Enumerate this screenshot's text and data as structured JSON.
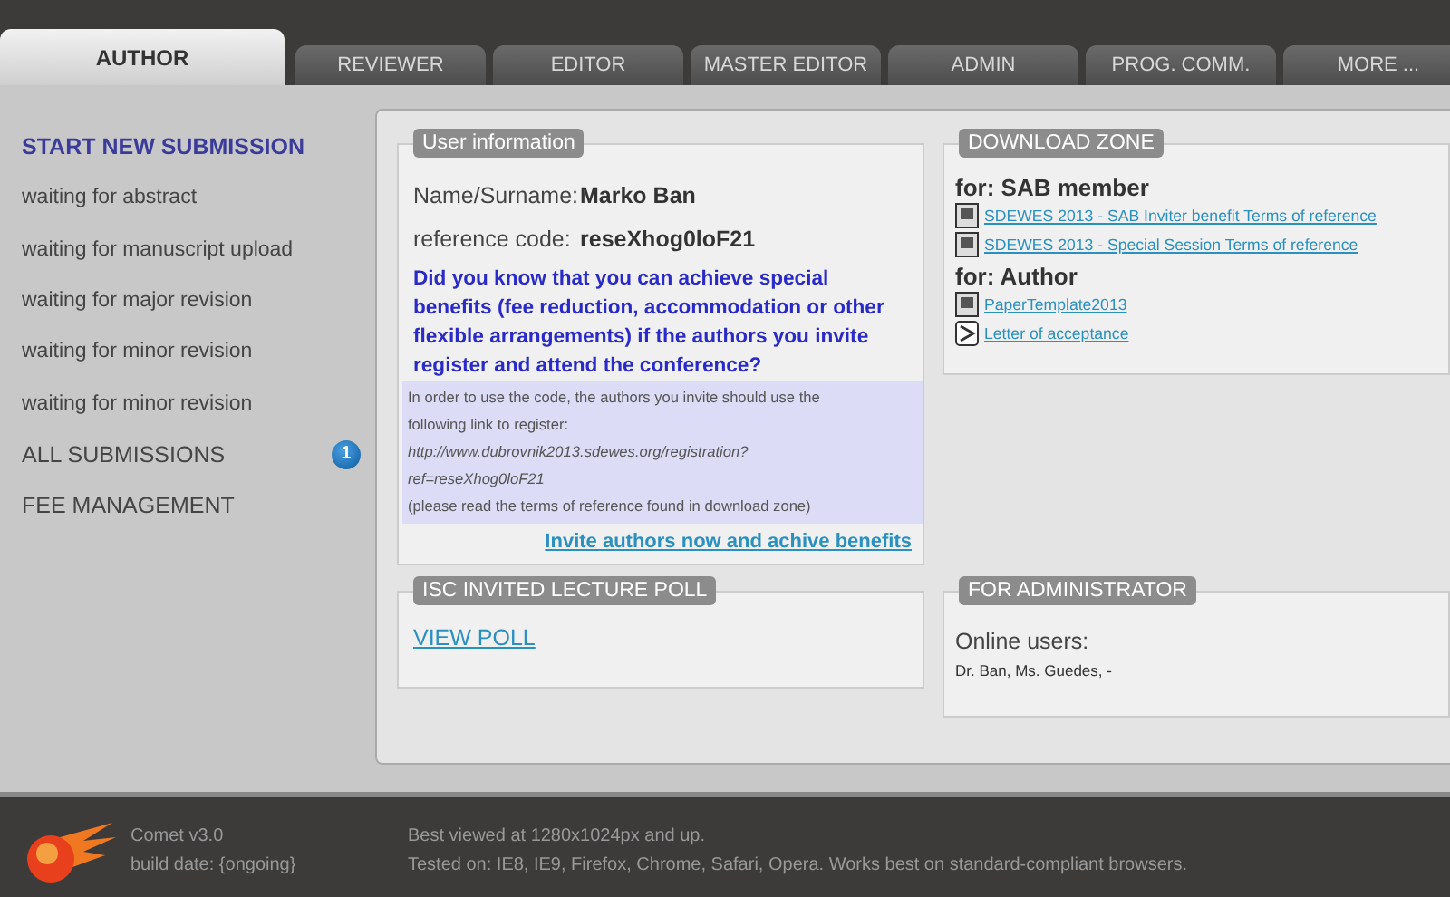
{
  "tabs": [
    {
      "label": "AUTHOR",
      "selected": true
    },
    {
      "label": "REVIEWER",
      "selected": false
    },
    {
      "label": "EDITOR",
      "selected": false
    },
    {
      "label": "MASTER EDITOR",
      "selected": false
    },
    {
      "label": "ADMIN",
      "selected": false
    },
    {
      "label": "PROG. COMM.",
      "selected": false
    },
    {
      "label": "MORE ...",
      "selected": false
    }
  ],
  "sidebar": {
    "items": [
      {
        "label": "START NEW SUBMISSION",
        "kind": "action"
      },
      {
        "label": "waiting for abstract",
        "kind": "filter"
      },
      {
        "label": "waiting for manuscript upload",
        "kind": "filter"
      },
      {
        "label": "waiting for major revision",
        "kind": "filter"
      },
      {
        "label": "waiting for minor revision",
        "kind": "filter"
      },
      {
        "label": "waiting for minor revision",
        "kind": "filter"
      },
      {
        "label": "ALL SUBMISSIONS",
        "kind": "section",
        "badge": "1"
      },
      {
        "label": "FEE MANAGEMENT",
        "kind": "section"
      }
    ]
  },
  "user_information": {
    "title": "User information",
    "fields": [
      {
        "label": "Name/Surname:",
        "value": "Marko Ban"
      },
      {
        "label": "reference code:",
        "value": "reseXhog0loF21"
      }
    ],
    "notice": "Did you know that you can achieve special benefits (fee reduction, accommodation or other flexible arrangements) if the authors you invite register and attend the conference?",
    "instructions": [
      {
        "text": "In order to use the code, the authors you invite should use the",
        "kind": "plain"
      },
      {
        "text": "following link to register:",
        "kind": "plain"
      },
      {
        "text": "http://www.dubrovnik2013.sdewes.org/registration?",
        "kind": "url"
      },
      {
        "text": "ref=reseXhog0loF21",
        "kind": "url"
      },
      {
        "text": "(please read the terms of reference found in download zone)",
        "kind": "plain"
      }
    ],
    "link": "Invite authors now and achive benefits"
  },
  "download_zone": {
    "title": "DOWNLOAD ZONE",
    "groups": [
      {
        "heading": "for: SAB member",
        "files": [
          {
            "label": "SDEWES 2013 - SAB Inviter benefit Terms of reference",
            "kind": "doc"
          },
          {
            "label": "SDEWES 2013 - Special Session Terms of reference",
            "kind": "doc"
          }
        ]
      },
      {
        "heading": "for: Author",
        "files": [
          {
            "label": "PaperTemplate2013",
            "kind": "doc"
          },
          {
            "label": "Letter of acceptance",
            "kind": "pdf"
          }
        ]
      }
    ]
  },
  "poll": {
    "title": "ISC INVITED LECTURE POLL",
    "link": "VIEW POLL"
  },
  "administrator": {
    "title": "FOR ADMINISTRATOR",
    "heading": "Online users:",
    "users": "Dr. Ban, Ms. Guedes, -"
  },
  "footer": {
    "app": "Comet v3.0",
    "build": "build date: {ongoing}",
    "notes": [
      "Best viewed at 1280x1024px and up.",
      "Tested on: IE8, IE9, Firefox, Chrome, Safari, Opera. Works best on standard-compliant browsers."
    ]
  }
}
